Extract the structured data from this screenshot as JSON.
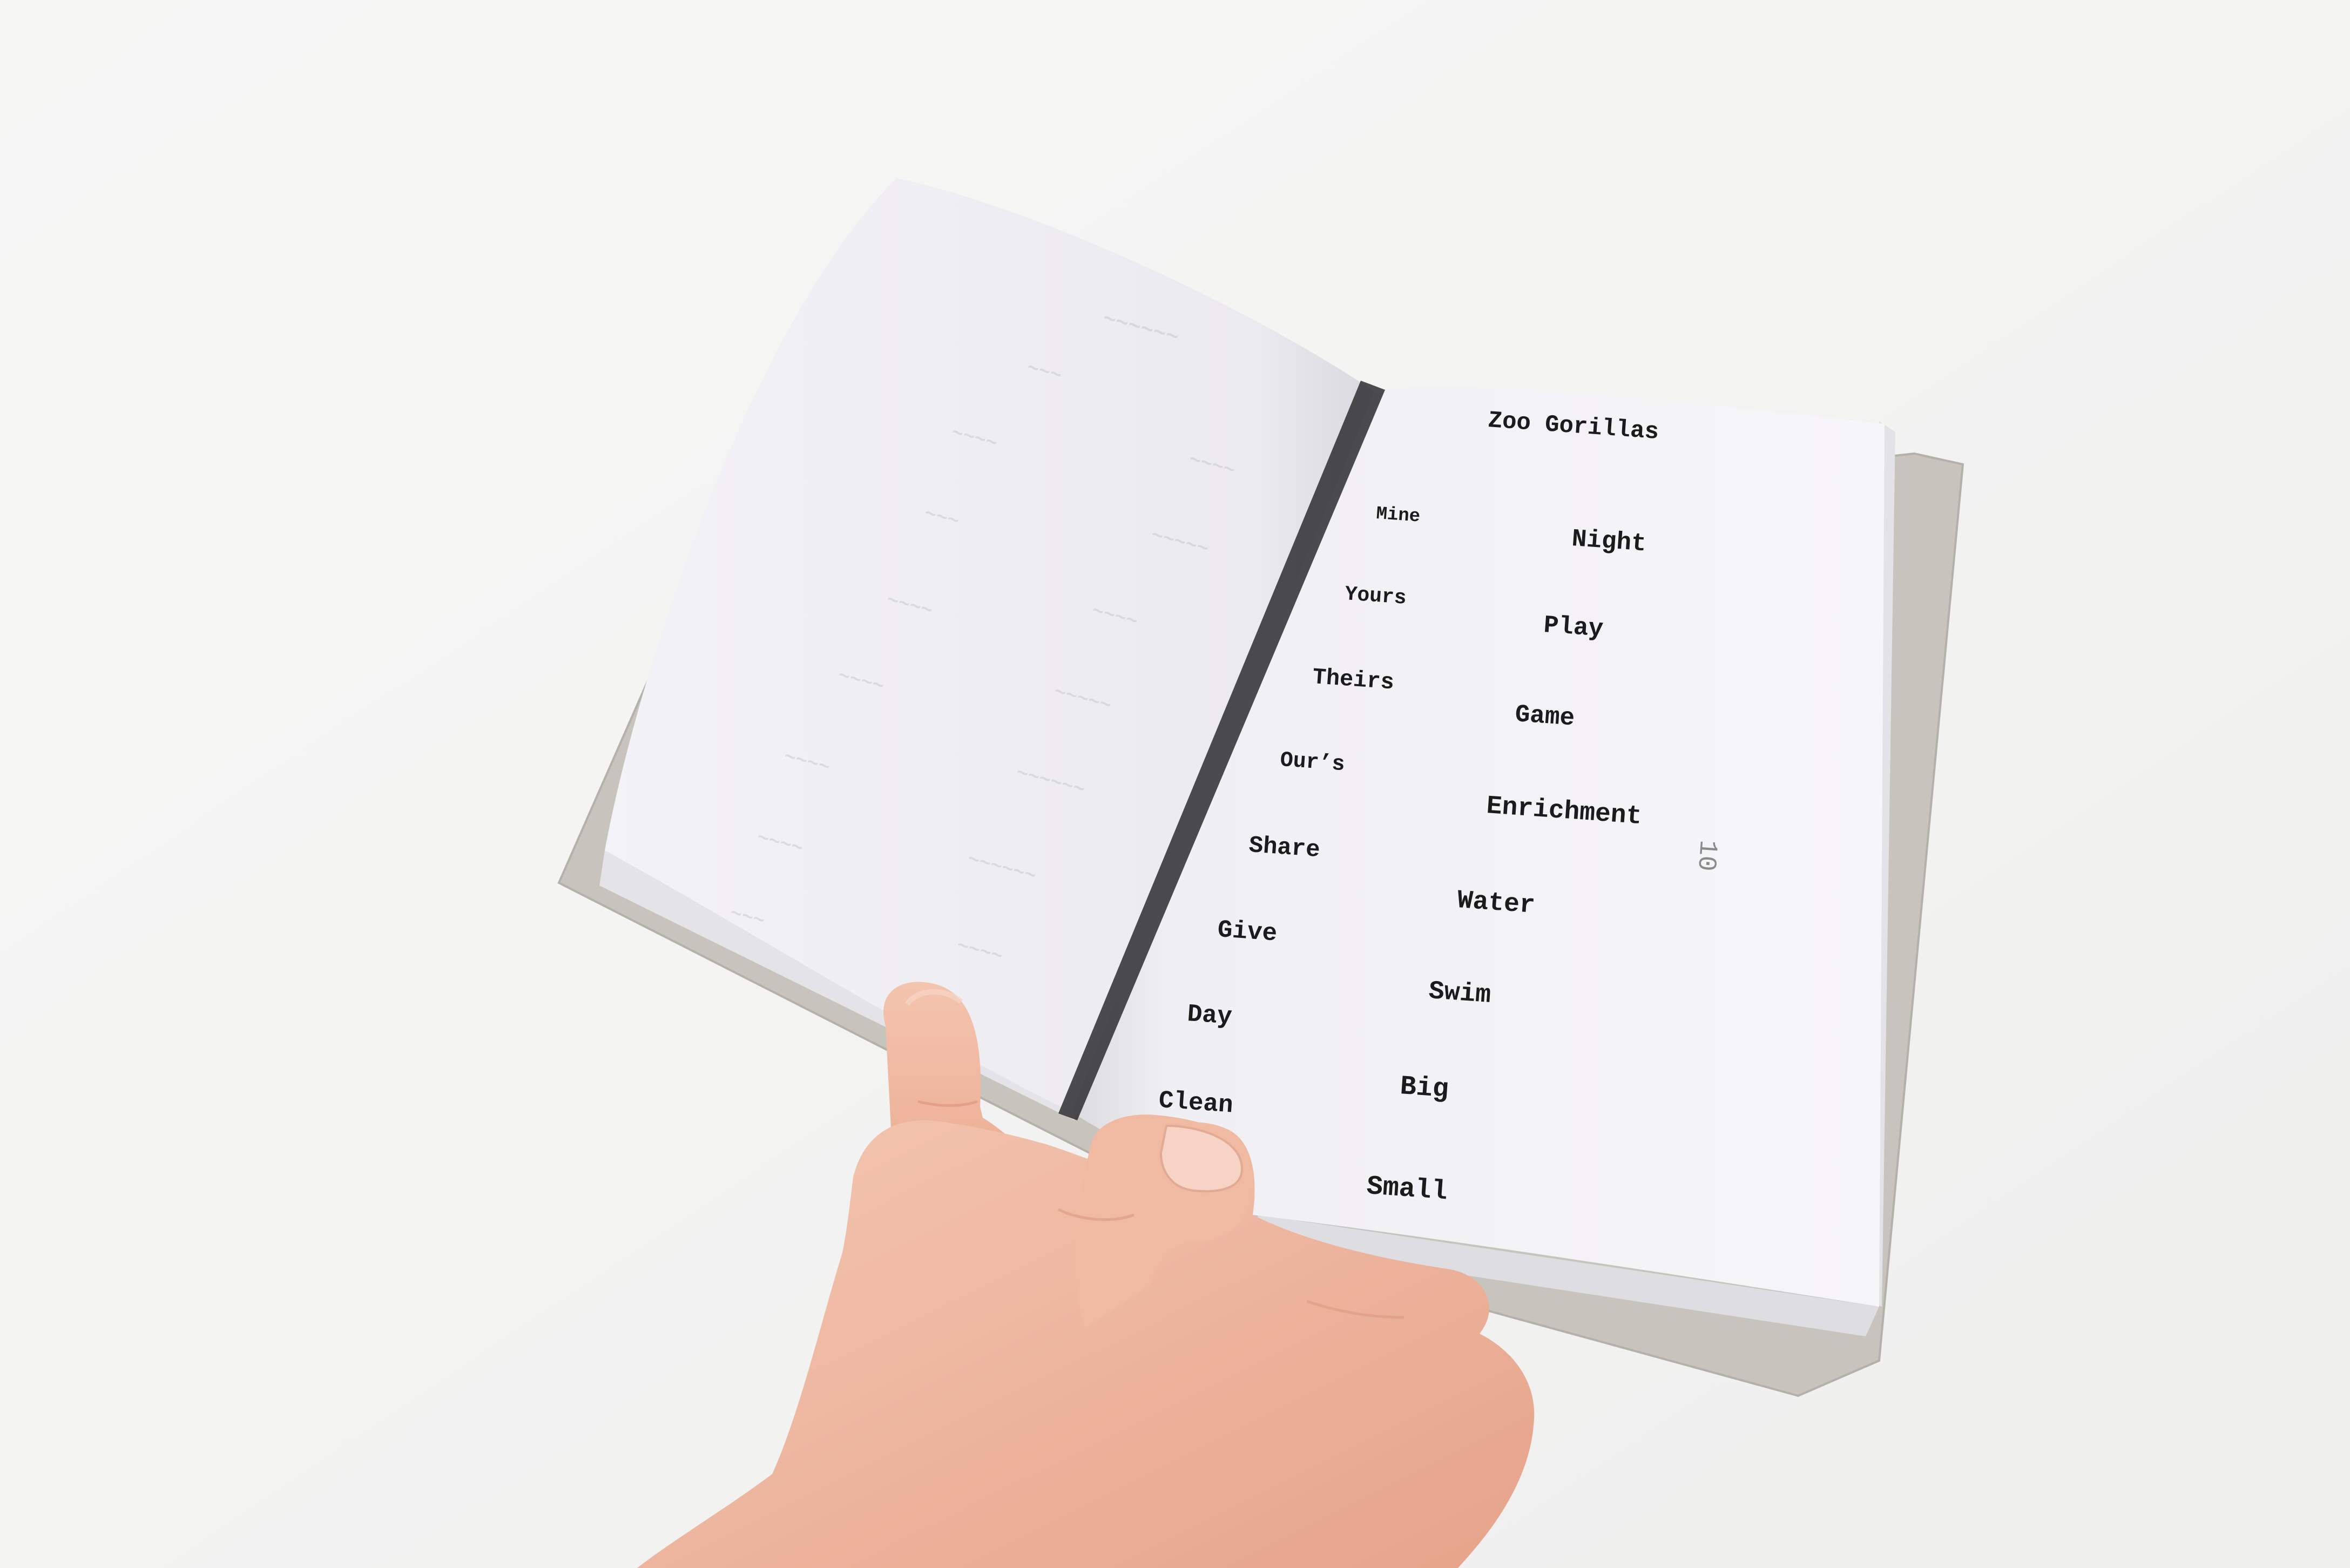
{
  "booklet": {
    "page_title": "Zoo Gorillas",
    "page_number": "10",
    "left_column_words": [
      "Mine",
      "Yours",
      "Theirs",
      "Our’s",
      "Share",
      "Give",
      "Day",
      "Clean"
    ],
    "right_column_words": [
      "Night",
      "Play",
      "Game",
      "Enrichment",
      "Water",
      "Swim",
      "Big",
      "Small"
    ]
  },
  "colors": {
    "background": "#f4f4f3",
    "paper": "#f2f1f4",
    "cover": "#c6c4bd",
    "ink": "#1b1b1b",
    "skin": "#f0b9a2"
  }
}
